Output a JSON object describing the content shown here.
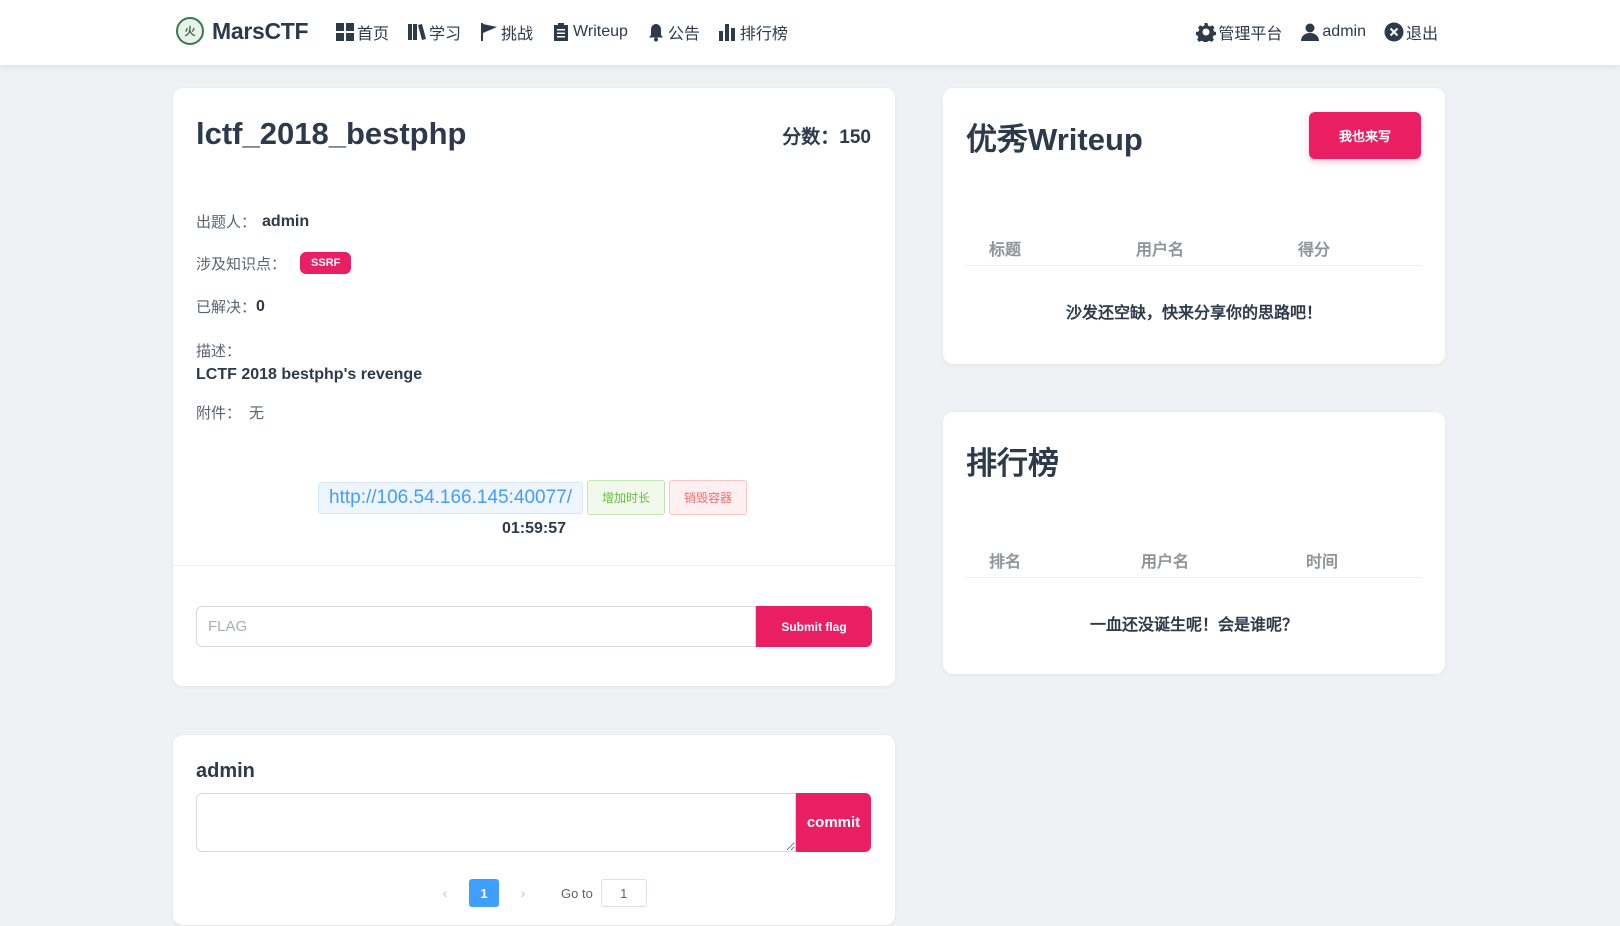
{
  "brand": {
    "logo_text": "火",
    "name": "MarsCTF"
  },
  "nav": {
    "home": "首页",
    "learn": "学习",
    "challenges": "挑战",
    "writeup": "Writeup",
    "notice": "公告",
    "rank": "排行榜",
    "admin_panel": "管理平台",
    "user": "admin",
    "logout": "退出"
  },
  "challenge": {
    "title": "lctf_2018_bestphp",
    "score_label": "分数：",
    "score": "150",
    "author_label": "出题人：",
    "author": "admin",
    "topic_label": "涉及知识点：",
    "topic_tag": "SSRF",
    "solved_label": "已解决：",
    "solved": "0",
    "desc_label": "描述：",
    "desc": "LCTF 2018 bestphp's revenge",
    "attachment_label": "附件：",
    "attachment": "无",
    "url": "http://106.54.166.145:40077/",
    "extend_label": "增加时长",
    "destroy_label": "销毁容器",
    "timer": "01:59:57",
    "flag_placeholder": "FLAG",
    "submit_label": "Submit flag"
  },
  "comment": {
    "user": "admin",
    "commit_label": "commit",
    "page": "1",
    "goto_label": "Go to",
    "goto_value": "1"
  },
  "writeups": {
    "title": "优秀Writeup",
    "write_label": "我也来写",
    "columns": [
      "标题",
      "用户名",
      "得分"
    ],
    "empty": "沙发还空缺，快来分享你的思路吧！"
  },
  "ranking": {
    "title": "排行榜",
    "columns": [
      "排名",
      "用户名",
      "时间"
    ],
    "empty": "一血还没诞生呢！会是谁呢？"
  },
  "colors": {
    "accent": "#e91e63",
    "link": "#409eff",
    "text": "#2d3a4b",
    "background": "#f0f1f5"
  }
}
